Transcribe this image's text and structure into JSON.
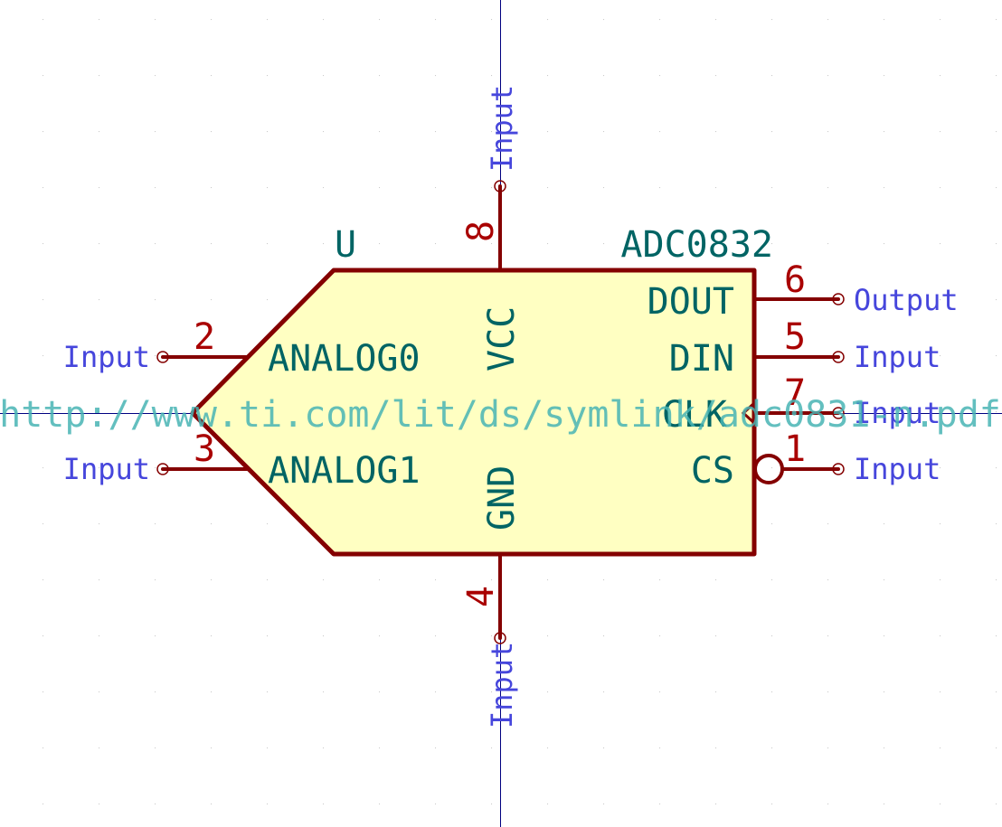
{
  "symbol": {
    "reference": "U",
    "value": "ADC0832",
    "datasheet_url": "http://www.ti.com/lit/ds/symlink/adc0831-n.pdf"
  },
  "pins": {
    "vcc": {
      "number": "8",
      "name": "VCC",
      "type": "Input"
    },
    "gnd": {
      "number": "4",
      "name": "GND",
      "type": "Input"
    },
    "analog0": {
      "number": "2",
      "name": "ANALOG0",
      "type": "Input"
    },
    "analog1": {
      "number": "3",
      "name": "ANALOG1",
      "type": "Input"
    },
    "dout": {
      "number": "6",
      "name": "DOUT",
      "type": "Output"
    },
    "din": {
      "number": "5",
      "name": "DIN",
      "type": "Input"
    },
    "clk": {
      "number": "7",
      "name": "CLK",
      "type": "Input"
    },
    "cs": {
      "number": "1",
      "name": "CS",
      "type": "Input"
    }
  },
  "colors": {
    "body_fill": "#ffffc2",
    "body_stroke": "#840000",
    "pin_line": "#840000",
    "pin_number": "#a90000",
    "pin_name": "#006464",
    "pin_type": "#4646dc",
    "datasheet_text": "#48b4b4",
    "grid_dot": "#c8c8c8",
    "crosshair": "#000080"
  }
}
